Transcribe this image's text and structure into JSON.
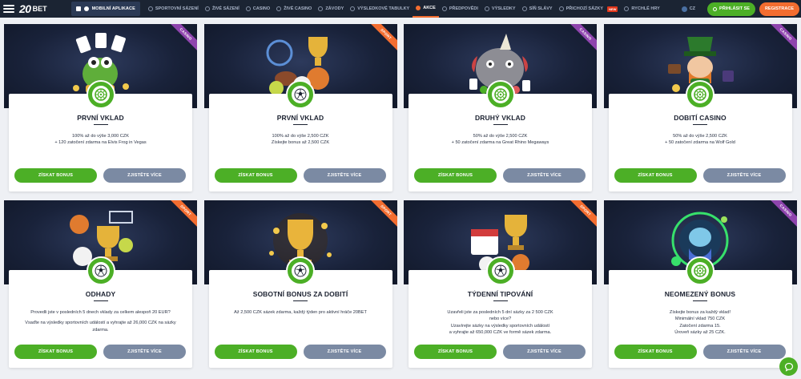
{
  "topbar": {
    "logo_num": "20",
    "logo_word": "BET",
    "mobile_label": "MOBILNÍ APLIKACE",
    "nav": [
      {
        "label": "SPORTOVNÍ SÁZENÍ",
        "icon": "ball-icon",
        "active": false
      },
      {
        "label": "ŽIVÉ SÁZENÍ",
        "icon": "live-icon",
        "active": false
      },
      {
        "label": "CASINO",
        "icon": "casino-icon",
        "active": false
      },
      {
        "label": "ŽIVÉ CASINO",
        "icon": "live-casino-icon",
        "active": false
      },
      {
        "label": "ZÁVODY",
        "icon": "horse-icon",
        "active": false
      },
      {
        "label": "VÝSLEDKOVÉ TABULKY",
        "icon": "trophy-icon",
        "active": false
      },
      {
        "label": "AKCE",
        "icon": "gift-icon",
        "active": true
      },
      {
        "label": "PŘEDPOVĚDI",
        "icon": "predict-icon",
        "active": false
      },
      {
        "label": "VÝSLEDKY",
        "icon": "results-icon",
        "active": false
      },
      {
        "label": "SÍŇ SLÁVY",
        "icon": "star-icon",
        "active": false
      },
      {
        "label": "PŘICHOZÍ SÁZKY",
        "icon": "incoming-icon",
        "active": false,
        "badge": "NEW"
      },
      {
        "label": "RYCHLÉ HRY",
        "icon": "rocket-icon",
        "active": false
      }
    ],
    "lang": "CZ",
    "login_label": "PŘIHLÁSIT SE",
    "register_label": "REGISTRACE"
  },
  "colors": {
    "accent_green": "#4caf26",
    "accent_orange": "#f36d30",
    "topbar_bg": "#1b2433",
    "casino_ribbon": "#8e44ad",
    "button_grey": "#7b8aa3"
  },
  "cards": [
    {
      "tag": "CASINO",
      "tag_kind": "casino",
      "art": "frog-cards-art",
      "icon": "roulette-icon",
      "title": "PRVNÍ VKLAD",
      "desc": [
        "100% až do výše 3,000 CZK",
        "+ 120 zatočení zdarma na Elvis Frog in Vegas"
      ],
      "primary": "ZÍSKAT BONUS",
      "secondary": "ZJISTĚTE VÍCE"
    },
    {
      "tag": "SPORT",
      "tag_kind": "sport",
      "art": "sport-balls-art",
      "icon": "football-icon",
      "title": "PRVNÍ VKLAD",
      "desc": [
        "100% až do výše 2,500 CZK",
        "Získejte bonus až 2,500 CZK"
      ],
      "primary": "ZÍSKAT BONUS",
      "secondary": "ZJISTĚTE VÍCE"
    },
    {
      "tag": "CASINO",
      "tag_kind": "casino",
      "art": "rhino-art",
      "icon": "roulette-icon",
      "title": "DRUHÝ VKLAD",
      "desc": [
        "50% až do výše 2,500 CZK",
        "+ 50 zatočení zdarma na Great Rhino Megaways"
      ],
      "primary": "ZÍSKAT BONUS",
      "secondary": "ZJISTĚTE VÍCE"
    },
    {
      "tag": "CASINO",
      "tag_kind": "casino",
      "art": "leprechaun-art",
      "icon": "roulette-icon",
      "title": "DOBITÍ CASINO",
      "desc": [
        "50% až do výše 2,500 CZK",
        "+ 50 zatočení zdarma na Wolf Gold"
      ],
      "primary": "ZÍSKAT BONUS",
      "secondary": "ZJISTĚTE VÍCE"
    },
    {
      "tag": "SPORT",
      "tag_kind": "sport",
      "art": "sport-trophy-art",
      "icon": "football-icon",
      "title": "ODHADY",
      "desc": [
        "Provedli jste v posledních 5 dnech vklady za celkem alespoň 20 EUR?",
        "",
        "Vsaďte na výsledky sportovních událostí a vyhrajte až 26,000 CZK na sázky",
        "zdarma."
      ],
      "primary": "ZÍSKAT BONUS",
      "secondary": "ZJISTĚTE VÍCE"
    },
    {
      "tag": "SPORT",
      "tag_kind": "sport",
      "art": "gold-trophy-art",
      "icon": "football-icon",
      "title": "SOBOTNÍ BONUS ZA DOBITÍ",
      "desc": [
        "Až 2,500 CZK sázek zdarma, každý týden pro aktivní hráče 20BET"
      ],
      "primary": "ZÍSKAT BONUS",
      "secondary": "ZJISTĚTE VÍCE"
    },
    {
      "tag": "SPORT",
      "tag_kind": "sport",
      "art": "calendar-trophy-art",
      "icon": "football-icon",
      "title": "TÝDENNÍ TIPOVÁNÍ",
      "desc": [
        "Uzavřeli jste za posledních 5 dní sázky za 2 500 CZK",
        "nebo více?",
        "Uzavírejte sázky na výsledky sportovních událostí",
        "a vyhrajte až 650,000 CZK ve formě sázek zdarma."
      ],
      "primary": "ZÍSKAT BONUS",
      "secondary": "ZJISTĚTE VÍCE"
    },
    {
      "tag": "CASINO",
      "tag_kind": "casino",
      "art": "neon-wizard-art",
      "icon": "roulette-icon",
      "title": "NEOMEZENÝ BONUS",
      "desc": [
        "Získejte bonus za každý vklad!",
        "Minimální vklad 750 CZK",
        "Zatočení zdarma 15.",
        "Úroveň sázky až 25 CZK."
      ],
      "primary": "ZÍSKAT BONUS",
      "secondary": "ZJISTĚTE VÍCE"
    }
  ]
}
